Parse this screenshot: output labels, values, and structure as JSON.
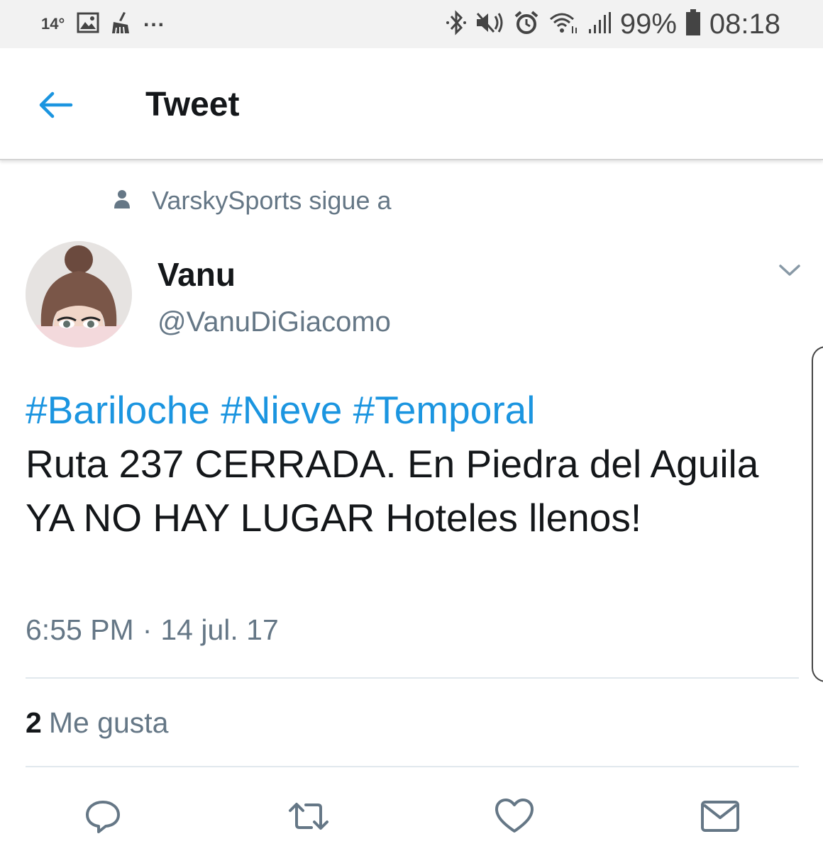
{
  "status_bar": {
    "temperature": "14°",
    "more": "...",
    "battery": "99%",
    "time": "08:18",
    "icons": [
      "image-icon",
      "cleaner-icon",
      "bluetooth-icon",
      "mute-icon",
      "alarm-icon",
      "wifi-icon",
      "signal-icon",
      "battery-icon"
    ]
  },
  "app_bar": {
    "title": "Tweet",
    "back_icon": "arrow-left-icon"
  },
  "social_context": {
    "text": "VarskySports sigue a",
    "icon": "person-icon"
  },
  "tweet": {
    "author_name": "Vanu",
    "handle": "@VanuDiGiacomo",
    "hashtags": [
      "#Bariloche",
      "#Nieve",
      "#Temporal"
    ],
    "text": "Ruta 237 CERRADA. En Piedra del Aguila YA NO HAY LUGAR Hoteles llenos!",
    "time": "6:55 PM",
    "separator": "·",
    "date": "14 jul. 17",
    "likes_count": "2",
    "likes_label": "Me gusta"
  },
  "actions": [
    "reply-icon",
    "retweet-icon",
    "like-icon",
    "dm-icon"
  ],
  "colors": {
    "accent": "#1b95e0",
    "text": "#14171a",
    "secondary": "#657786",
    "divider": "#e1e8ed",
    "status_bar_bg": "#f2f2f2"
  }
}
